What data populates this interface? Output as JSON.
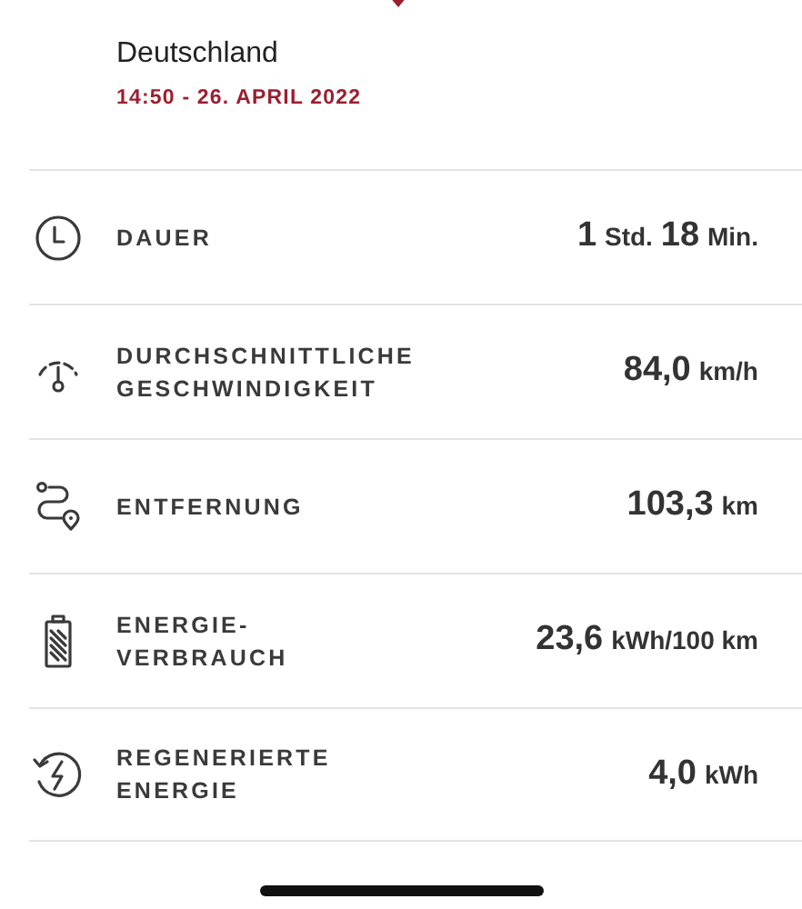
{
  "header": {
    "location": "Deutschland",
    "datetime": "14:50 - 26. APRIL 2022"
  },
  "stats": [
    {
      "kind": "clock",
      "label_lines": [
        "DAUER"
      ],
      "value_parts": [
        {
          "kind": "number",
          "text": "1"
        },
        {
          "kind": "unit",
          "text": "Std."
        },
        {
          "kind": "number",
          "text": "18"
        },
        {
          "kind": "unit",
          "text": "Min."
        }
      ]
    },
    {
      "kind": "gauge",
      "label_lines": [
        "DURCHSCHNITTLICHE",
        "GESCHWINDIGKEIT"
      ],
      "value_parts": [
        {
          "kind": "number",
          "text": "84,0"
        },
        {
          "kind": "unit",
          "text": "km/h"
        }
      ]
    },
    {
      "kind": "route",
      "label_lines": [
        "ENTFERNUNG"
      ],
      "value_parts": [
        {
          "kind": "number",
          "text": "103,3"
        },
        {
          "kind": "unit",
          "text": "km"
        }
      ]
    },
    {
      "kind": "battery",
      "label_lines": [
        "ENERGIE-",
        "VERBRAUCH"
      ],
      "value_parts": [
        {
          "kind": "number",
          "text": "23,6"
        },
        {
          "kind": "unit",
          "text": "kWh/100 km"
        }
      ]
    },
    {
      "kind": "regen",
      "label_lines": [
        "REGENERIERTE",
        "ENERGIE"
      ],
      "value_parts": [
        {
          "kind": "number",
          "text": "4,0"
        },
        {
          "kind": "unit",
          "text": "kWh"
        }
      ]
    }
  ]
}
